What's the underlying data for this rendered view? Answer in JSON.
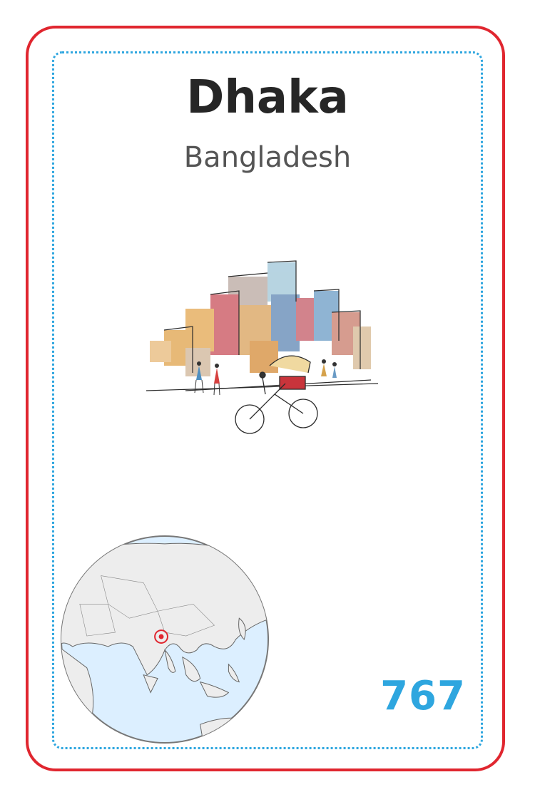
{
  "card": {
    "city": "Dhaka",
    "country": "Bangladesh",
    "number": "767",
    "colors": {
      "border": "#e0262f",
      "dashed_inner_border": "#2ea6df",
      "number": "#2ea6df",
      "city_text": "#262626",
      "country_text": "#555555",
      "ocean": "#dcefff",
      "land": "#ededed",
      "marker": "#e0262f"
    },
    "illustration": "watercolor-city-street-with-rickshaw",
    "globe": "globe-centered-on-asia-with-location-marker"
  }
}
